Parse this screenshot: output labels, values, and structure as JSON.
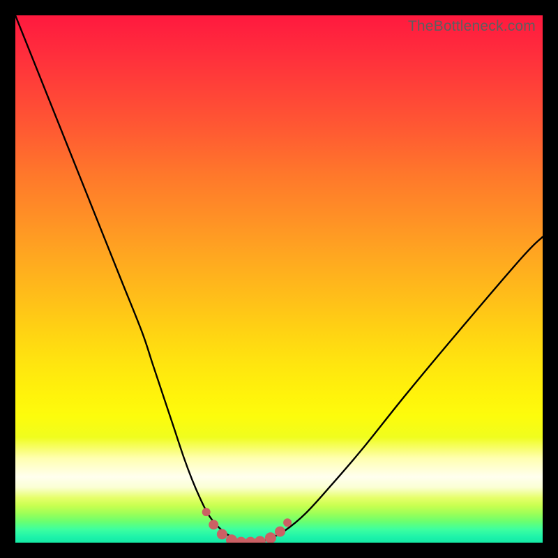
{
  "watermark": "TheBottleneck.com",
  "colors": {
    "frame": "#000000",
    "curve_stroke": "#000000",
    "marker_fill": "#cc6b6a",
    "marker": "#cb6064"
  },
  "chart_data": {
    "type": "line",
    "title": "",
    "xlabel": "",
    "ylabel": "",
    "xlim": [
      0,
      100
    ],
    "ylim": [
      0,
      100
    ],
    "grid": false,
    "legend": false,
    "series": [
      {
        "name": "bottleneck-curve",
        "x": [
          0,
          4,
          8,
          12,
          16,
          20,
          24,
          26,
          28,
          30,
          32,
          33.5,
          35,
          36.5,
          38,
          40,
          42,
          44,
          46,
          48,
          51,
          55,
          60,
          66,
          74,
          84,
          96,
          100
        ],
        "y": [
          100,
          90,
          80,
          70,
          60,
          50,
          40,
          34,
          28,
          22,
          16,
          12,
          8.5,
          5.5,
          3.5,
          1.7,
          0.6,
          0.1,
          0.1,
          0.7,
          2.2,
          5.5,
          11,
          18,
          28,
          40,
          54,
          58
        ]
      }
    ],
    "markers": {
      "name": "trough-markers",
      "x": [
        36.2,
        37.6,
        39.2,
        41.0,
        42.8,
        44.6,
        46.4,
        48.4,
        50.2,
        51.6
      ],
      "y": [
        5.8,
        3.4,
        1.6,
        0.5,
        0.05,
        0.05,
        0.2,
        0.9,
        2.1,
        3.8
      ],
      "r": [
        6,
        7,
        7.5,
        8,
        8,
        8,
        8,
        8,
        7.5,
        6
      ]
    }
  }
}
